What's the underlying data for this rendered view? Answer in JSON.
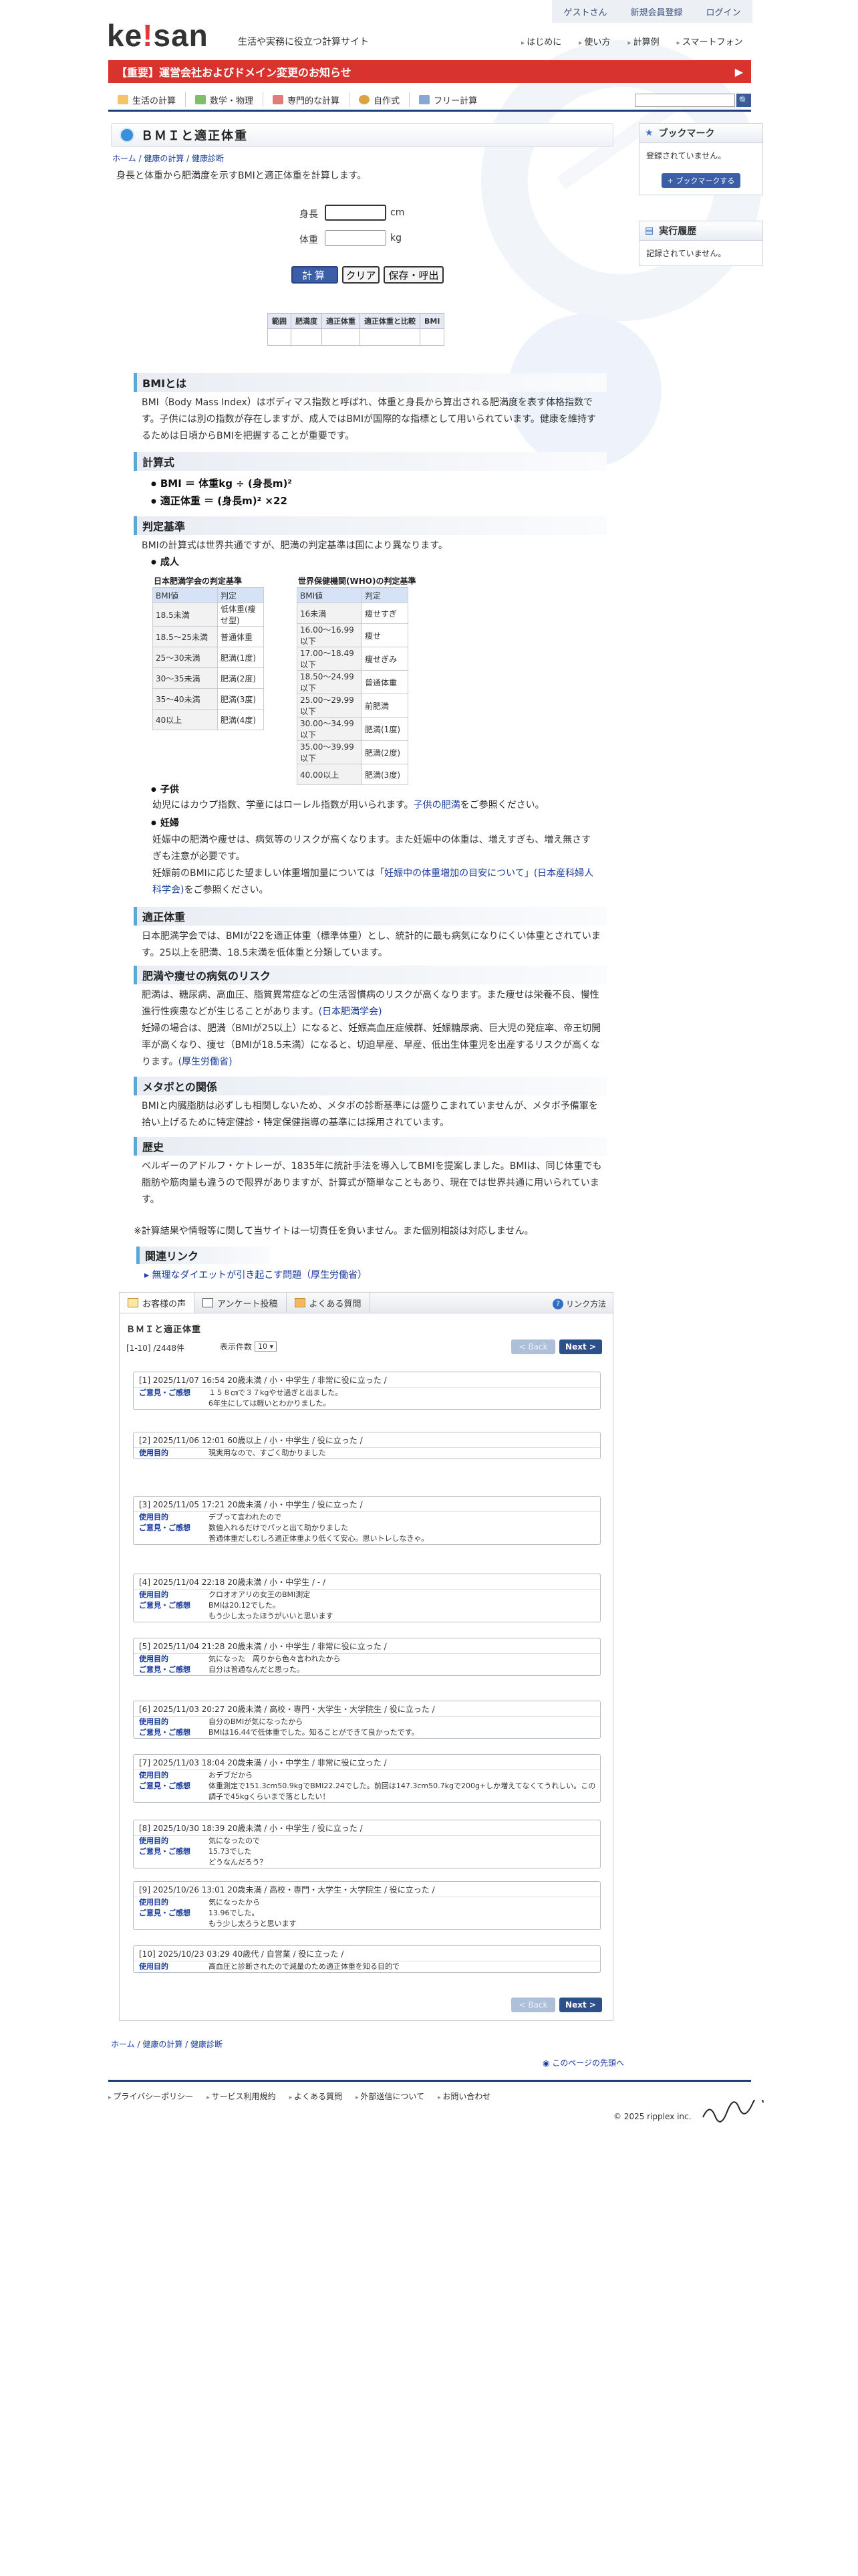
{
  "header": {
    "logo": "keisan",
    "tagline": "生活や実務に役立つ計算サイト",
    "topbar": [
      "ゲストさん",
      "新規会員登録",
      "ログイン"
    ],
    "gnav": [
      "はじめに",
      "使い方",
      "計算例",
      "スマートフォン"
    ],
    "notice": "【重要】運営会社およびドメイン変更のお知らせ",
    "notice_arrow": "▶",
    "categories": [
      "生活の計算",
      "数学・物理",
      "専門的な計算",
      "自作式",
      "フリー計算"
    ],
    "search_icon_glyph": "🔍"
  },
  "page": {
    "title": "ＢＭＩと適正体重",
    "breadcrumb": [
      "ホーム",
      "健康の計算",
      "健康診断"
    ],
    "lead": "身長と体重から肥満度を示すBMIと適正体重を計算します。",
    "form": {
      "height_label": "身長",
      "height_unit": "cm",
      "weight_label": "体重",
      "weight_unit": "kg"
    },
    "buttons": {
      "calc": "計算",
      "clear": "クリア",
      "save": "保存・呼出"
    },
    "result_headers": [
      "範囲",
      "肥満度",
      "適正体重",
      "適正体重と比較",
      "BMI"
    ]
  },
  "sections": {
    "bmi_title": "BMIとは",
    "bmi_text": "BMI（Body Mass Index）はボディマス指数と呼ばれ、体重と身長から算出される肥満度を表す体格指数です。子供には別の指数が存在しますが、成人ではBMIが国際的な指標として用いられています。健康を維持するためは日頃からBMIを把握することが重要です。",
    "formula_title": "計算式",
    "formula1": "BMI ＝ 体重kg ÷ (身長m)²",
    "formula2": "適正体重 ＝ (身長m)² ×22",
    "criteria_title": "判定基準",
    "criteria_text": "BMIの計算式は世界共通ですが、肥満の判定基準は国により異なります。",
    "adult_label": "成人",
    "jp_table_title": "日本肥満学会の判定基準",
    "jp_table": [
      [
        "BMI値",
        "判定"
      ],
      [
        "18.5未満",
        "低体重(痩せ型)"
      ],
      [
        "18.5〜25未満",
        "普通体重"
      ],
      [
        "25〜30未満",
        "肥満(1度)"
      ],
      [
        "30〜35未満",
        "肥満(2度)"
      ],
      [
        "35〜40未満",
        "肥満(3度)"
      ],
      [
        "40以上",
        "肥満(4度)"
      ]
    ],
    "who_table_title": "世界保健機関(WHO)の判定基準",
    "who_table": [
      [
        "BMI値",
        "判定"
      ],
      [
        "16未満",
        "痩せすぎ"
      ],
      [
        "16.00〜16.99以下",
        "痩せ"
      ],
      [
        "17.00〜18.49以下",
        "痩せぎみ"
      ],
      [
        "18.50〜24.99以下",
        "普通体重"
      ],
      [
        "25.00〜29.99以下",
        "前肥満"
      ],
      [
        "30.00〜34.99以下",
        "肥満(1度)"
      ],
      [
        "35.00〜39.99以下",
        "肥満(2度)"
      ],
      [
        "40.00以上",
        "肥満(3度)"
      ]
    ],
    "child_label": "子供",
    "child_text_pre": "幼児にはカウプ指数、学童にはローレル指数が用いられます。",
    "child_link": "子供の肥満",
    "child_text_post": "をご参照ください。",
    "preg_label": "妊婦",
    "preg_text1": "妊娠中の肥満や痩せは、病気等のリスクが高くなります。また妊娠中の体重は、増えすぎも、増え無さすぎも注意が必要です。",
    "preg_text2_pre": "妊娠前のBMIに応じた望ましい体重増加量については「",
    "preg_link": "妊娠中の体重増加の目安について」(日本産科婦人科学会)",
    "preg_text2_post": "をご参照ください。",
    "ideal_title": "適正体重",
    "ideal_text": "日本肥満学会では、BMIが22を適正体重（標準体重）とし、統計的に最も病気になりにくい体重とされています。25以上を肥満、18.5未満を低体重と分類しています。",
    "risk_title": "肥満や痩せの病気のリスク",
    "risk_text1_pre": "肥満は、糖尿病、高血圧、脂質異常症などの生活習慣病のリスクが高くなります。また痩せは栄養不良、慢性進行性疾患などが生じることがあります。",
    "risk_link1": "(日本肥満学会)",
    "risk_text2_pre": "妊婦の場合は、肥満（BMIが25以上）になると、妊娠高血圧症候群、妊娠糖尿病、巨大児の発症率、帝王切開率が高くなり、痩せ（BMIが18.5未満）になると、切迫早産、早産、低出生体重児を出産するリスクが高くなります。",
    "risk_link2": "(厚生労働省)",
    "meta_title": "メタボとの関係",
    "meta_text": "BMIと内臓脂肪は必ずしも相関しないため、メタボの診断基準には盛りこまれていませんが、メタボ予備軍を拾い上げるために特定健診・特定保健指導の基準には採用されています。",
    "history_title": "歴史",
    "history_text": "ベルギーのアドルフ・ケトレーが、1835年に統計手法を導入してBMIを提案しました。BMIは、同じ体重でも脂肪や筋肉量も違うので限界がありますが、計算式が簡単なこともあり、現在では世界共通に用いられています。",
    "disclaimer": "※計算結果や情報等に関して当サイトは一切責任を負いません。また個別相談は対応しません。",
    "related_title": "関連リンク",
    "related_link": "無理なダイエットが引き起こす問題（厚生労働省）"
  },
  "voices": {
    "tabs": [
      "お客様の声",
      "アンケート投稿",
      "よくある質問"
    ],
    "link_way": "リンク方法",
    "title": "ＢＭＩと適正体重",
    "count": "[1-10] /2448件",
    "show_label": "表示件数",
    "show_value": "10 ▾",
    "back": "< Back",
    "next": "Next >",
    "entries": [
      {
        "head": "[1]  2025/11/07 16:54   20歳未満 / 小・中学生 / 非常に役に立った /",
        "rows": [
          [
            "ご意見・ご感想",
            "１５８㎝で３７kgやせ過ぎと出ました。\n6年生にしては軽いとわかりました。"
          ]
        ]
      },
      {
        "head": "[2]  2025/11/06 12:01   60歳以上 / 小・中学生 / 役に立った /",
        "rows": [
          [
            "使用目的",
            "現実用なので、すごく助かりました"
          ]
        ]
      },
      {
        "head": "[3]  2025/11/05 17:21   20歳未満 / 小・中学生 / 役に立った /",
        "rows": [
          [
            "使用目的",
            "デブって言われたので"
          ],
          [
            "ご意見・ご感想",
            "数値入れるだけでパッと出て助かりました\n普通体重だしむしろ適正体重より低くて安心。思いトレしなきゃ。"
          ]
        ]
      },
      {
        "head": "[4]  2025/11/04 22:18   20歳未満 / 小・中学生 / - /",
        "rows": [
          [
            "使用目的",
            "クロオオアリの女王のBMI測定"
          ],
          [
            "ご意見・ご感想",
            "BMIは20.12でした。\nもう少し太ったほうがいいと思います"
          ]
        ]
      },
      {
        "head": "[5]  2025/11/04 21:28   20歳未満 / 小・中学生 / 非常に役に立った /",
        "rows": [
          [
            "使用目的",
            "気になった　周りから色々言われたから"
          ],
          [
            "ご意見・ご感想",
            "自分は普通なんだと思った。"
          ]
        ]
      },
      {
        "head": "[6]  2025/11/03 20:27   20歳未満 / 高校・専門・大学生・大学院生 / 役に立った /",
        "rows": [
          [
            "使用目的",
            "自分のBMIが気になったから"
          ],
          [
            "ご意見・ご感想",
            "BMIは16.44で低体重でした。知ることができて良かったです。"
          ]
        ]
      },
      {
        "head": "[7]  2025/11/03 18:04   20歳未満 / 小・中学生 / 非常に役に立った /",
        "rows": [
          [
            "使用目的",
            "おデブだから"
          ],
          [
            "ご意見・ご感想",
            "体重測定で151.3cm50.9kgでBMI22.24でした。前回は147.3cm50.7kgで200g+しか増えてなくてうれしい。この調子で45kgくらいまで落としたい！"
          ]
        ]
      },
      {
        "head": "[8]  2025/10/30 18:39   20歳未満 / 小・中学生 / 役に立った /",
        "rows": [
          [
            "使用目的",
            "気になったので"
          ],
          [
            "ご意見・ご感想",
            "15.73でした\nどうなんだろう？"
          ]
        ]
      },
      {
        "head": "[9]  2025/10/26 13:01   20歳未満 / 高校・専門・大学生・大学院生 / 役に立った /",
        "rows": [
          [
            "使用目的",
            "気になったから"
          ],
          [
            "ご意見・ご感想",
            "13.96でした。\nもう少し太ろうと思います"
          ]
        ]
      },
      {
        "head": "[10]  2025/10/23 03:29   40歳代 / 自営業 / 役に立った /",
        "rows": [
          [
            "使用目的",
            "高血圧と診断されたので減量のため適正体重を知る目的で"
          ]
        ]
      }
    ]
  },
  "footer": {
    "breadcrumb": [
      "ホーム",
      "健康の計算",
      "健康診断"
    ],
    "pagetop": "このページの先頭へ",
    "links": [
      "プライバシーポリシー",
      "サービス利用規約",
      "よくある質問",
      "外部送信について",
      "お問い合わせ"
    ],
    "copyright": "© 2025 ripplex inc."
  },
  "sidebar": {
    "bookmark_title": "ブックマーク",
    "bookmark_text": "登録されていません。",
    "bookmark_button": "+ ブックマークする",
    "history_title": "実行履歴",
    "history_text": "記録されていません。"
  },
  "colors": {
    "brand_navy": "#1c3d7a",
    "notice_red": "#d9332f",
    "button_blue": "#3c5da8",
    "section_accent": "#5aa7d8"
  }
}
